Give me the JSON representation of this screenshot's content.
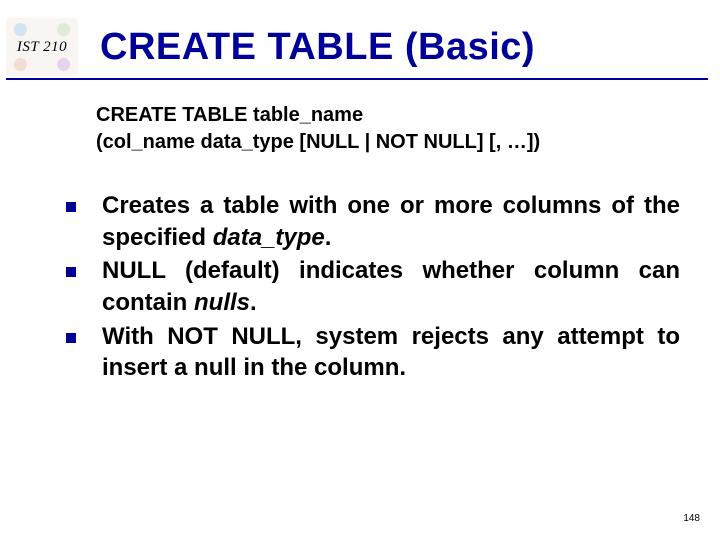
{
  "course_label": "IST 210",
  "title": "CREATE TABLE (Basic)",
  "syntax": {
    "line1": "CREATE TABLE table_name",
    "line2": "(col_name data_type [NULL | NOT NULL] [, …])"
  },
  "bullets": [
    {
      "pre": "Creates a table with one or more columns of the specified ",
      "em": "data_type",
      "post": "."
    },
    {
      "pre": "NULL (default) indicates whether column can contain ",
      "em": "nulls",
      "post": "."
    },
    {
      "pre": "With NOT NULL, system rejects any attempt to insert a null in the column.",
      "em": "",
      "post": ""
    }
  ],
  "page_number": "148"
}
